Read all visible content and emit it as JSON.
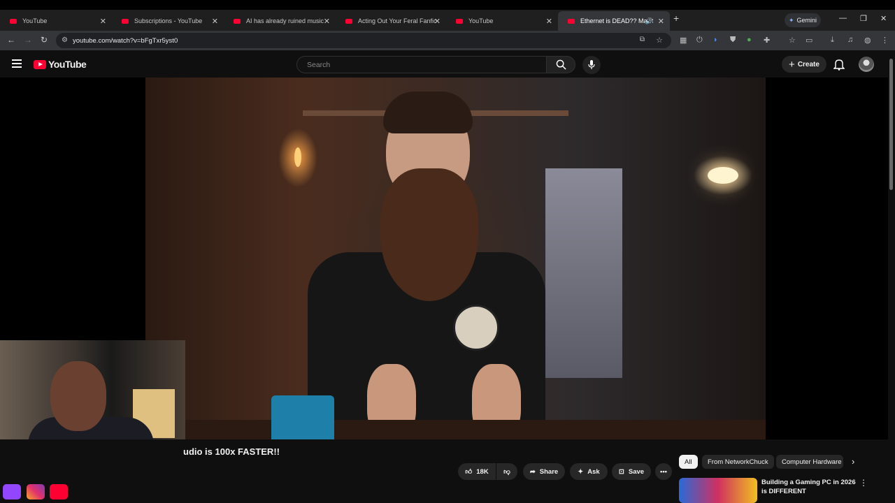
{
  "browser": {
    "tabs": [
      {
        "title": "YouTube"
      },
      {
        "title": "Subscriptions - YouTube"
      },
      {
        "title": "AI has already ruined music"
      },
      {
        "title": "Acting Out Your Feral Fanfic"
      },
      {
        "title": "YouTube"
      },
      {
        "title": "Ethernet is DEAD?? Mac Stu"
      }
    ],
    "new_tab": "+",
    "gemini_label": "Gemini",
    "url": "youtube.com/watch?v=bFgTxr5yst0"
  },
  "youtube": {
    "logo_text": "YouTube",
    "search_placeholder": "Search",
    "create_label": "Create"
  },
  "video": {
    "title_visible": "udio is 100x FASTER!!",
    "likes": "18K",
    "share_label": "Share",
    "ask_label": "Ask",
    "save_label": "Save"
  },
  "sidebar": {
    "chips": [
      "All",
      "From NetworkChuck",
      "Computer Hardware"
    ],
    "recommendation_title": "Building a Gaming PC in 2026 is DIFFERENT"
  },
  "colors": {
    "youtube_red": "#ff0033",
    "twitch": "#9146ff",
    "instagram": "#e1306c"
  }
}
